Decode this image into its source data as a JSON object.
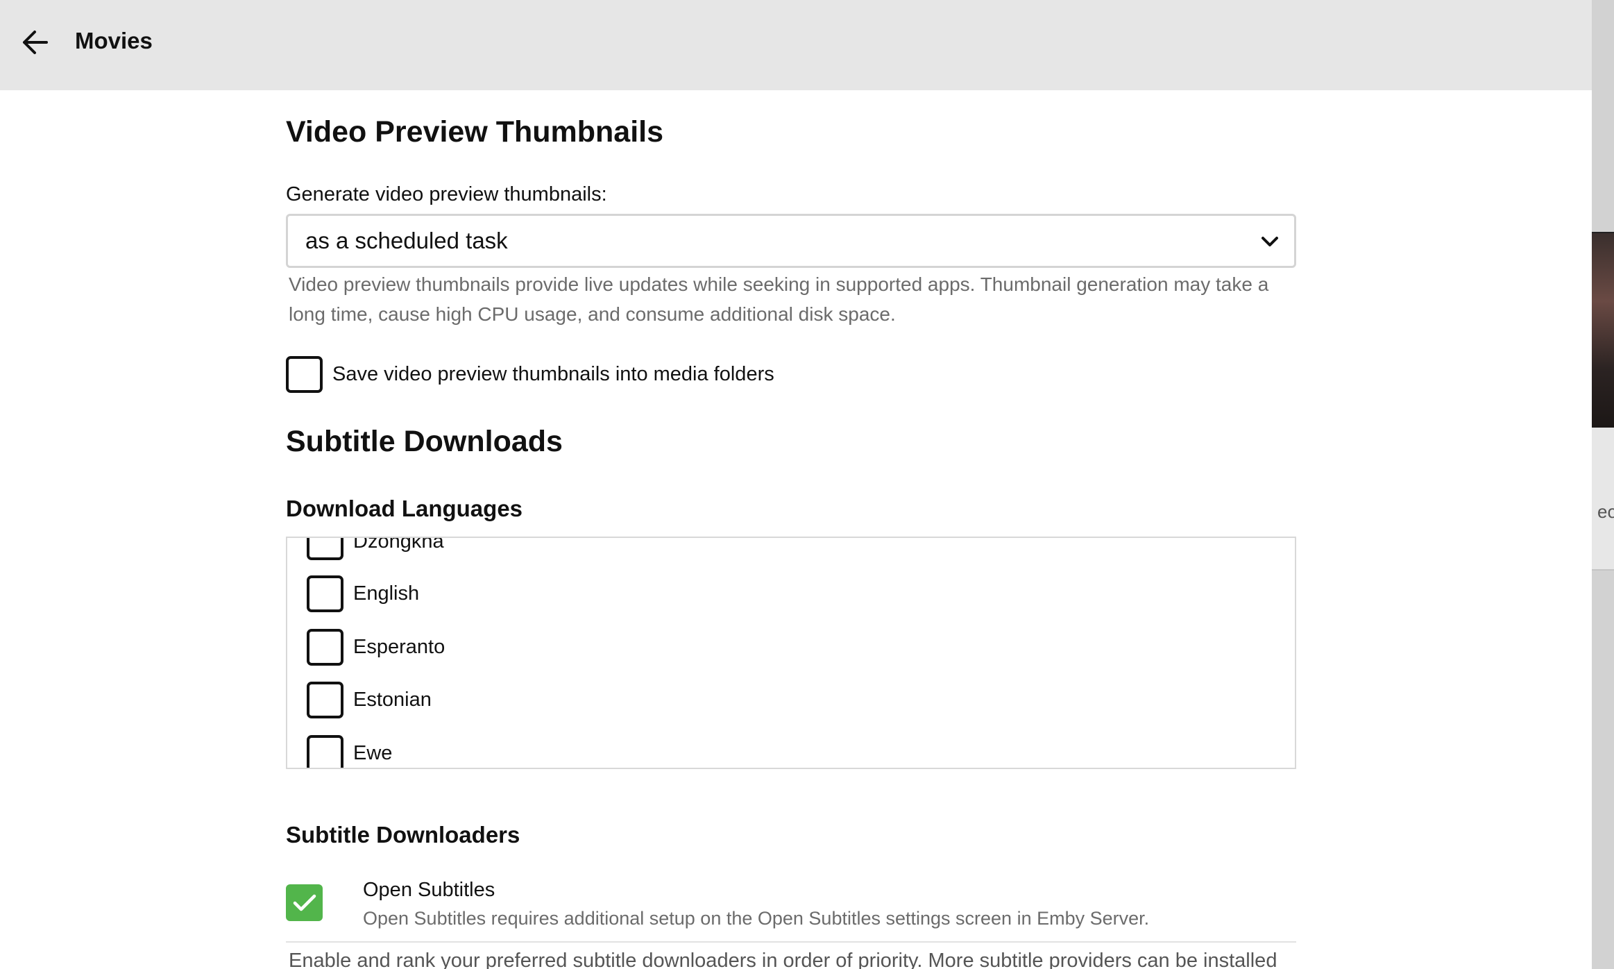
{
  "header": {
    "title": "Movies",
    "back_icon": "arrow-left-icon"
  },
  "video_preview": {
    "heading": "Video Preview Thumbnails",
    "generate_label": "Generate video preview thumbnails:",
    "generate_value": "as a scheduled task",
    "help_text": "Video preview thumbnails provide live updates while seeking in supported apps. Thumbnail generation may take a long time, cause high CPU usage, and consume additional disk space.",
    "save_into_media_label": "Save video preview thumbnails into media folders",
    "save_into_media_checked": false
  },
  "subtitle_downloads": {
    "heading": "Subtitle Downloads",
    "languages_heading": "Download Languages",
    "languages": [
      {
        "label": "Dzongkha",
        "checked": false
      },
      {
        "label": "English",
        "checked": false
      },
      {
        "label": "Esperanto",
        "checked": false
      },
      {
        "label": "Estonian",
        "checked": false
      },
      {
        "label": "Ewe",
        "checked": false
      }
    ]
  },
  "subtitle_downloaders": {
    "heading": "Subtitle Downloaders",
    "items": [
      {
        "name": "Open Subtitles",
        "description": "Open Subtitles requires additional setup on the Open Subtitles settings screen in Emby Server.",
        "checked": true
      }
    ],
    "help_text": "Enable and rank your preferred subtitle downloaders in order of priority. More subtitle providers can be installed"
  },
  "background_peek_text": "eo",
  "colors": {
    "header_bg": "#e6e6e6",
    "accent_green": "#52b54b",
    "help_gray": "#6b6b6b"
  }
}
